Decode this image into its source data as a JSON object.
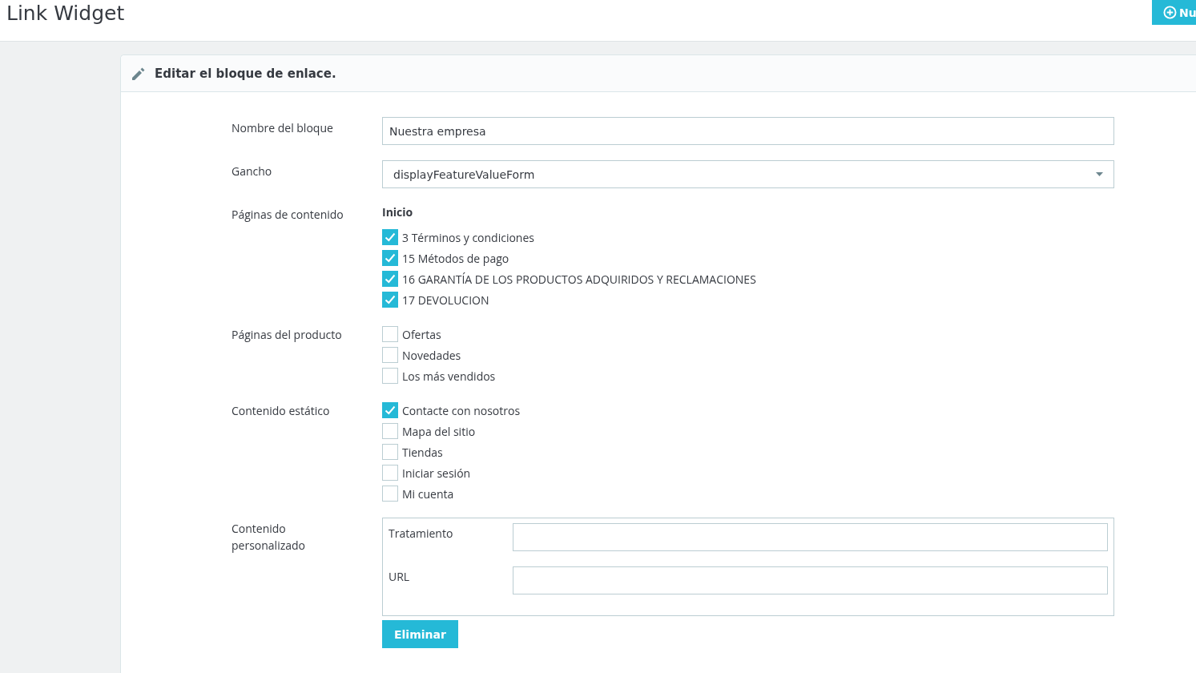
{
  "header": {
    "title": "Link Widget",
    "add_button": "Nu"
  },
  "panel": {
    "title": "Editar el bloque de enlace."
  },
  "form": {
    "name": {
      "label": "Nombre del bloque",
      "value": "Nuestra empresa"
    },
    "hook": {
      "label": "Gancho",
      "value": "displayFeatureValueForm"
    },
    "groups": [
      {
        "label": "Páginas de contenido",
        "heading": "Inicio",
        "items": [
          {
            "label": "3 Términos y condiciones",
            "checked": true
          },
          {
            "label": "15 Métodos de pago",
            "checked": true
          },
          {
            "label": "16 GARANTÍA DE LOS PRODUCTOS ADQUIRIDOS Y RECLAMACIONES",
            "checked": true
          },
          {
            "label": "17 DEVOLUCION",
            "checked": true
          }
        ]
      },
      {
        "label": "Páginas del producto",
        "items": [
          {
            "label": "Ofertas",
            "checked": false
          },
          {
            "label": "Novedades",
            "checked": false
          },
          {
            "label": "Los más vendidos",
            "checked": false
          }
        ]
      },
      {
        "label": "Contenido estático",
        "items": [
          {
            "label": "Contacte con nosotros",
            "checked": true
          },
          {
            "label": "Mapa del sitio",
            "checked": false
          },
          {
            "label": "Tiendas",
            "checked": false
          },
          {
            "label": "Iniciar sesión",
            "checked": false
          },
          {
            "label": "Mi cuenta",
            "checked": false
          }
        ]
      }
    ],
    "custom": {
      "label": "Contenido personalizado",
      "fields": [
        {
          "label": "Tratamiento"
        },
        {
          "label": "URL"
        }
      ],
      "delete_button": "Eliminar"
    }
  }
}
